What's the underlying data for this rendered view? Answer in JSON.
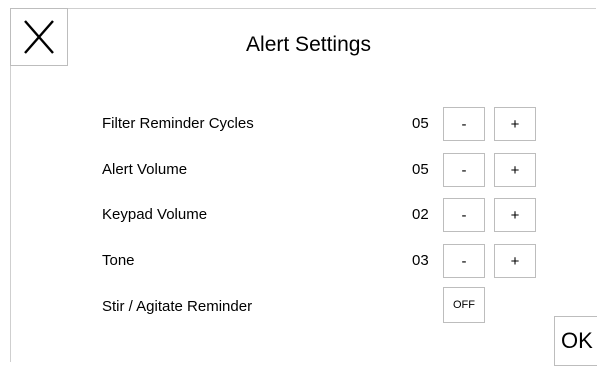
{
  "header": {
    "close_label": "X",
    "title": "Alert Settings"
  },
  "settings": [
    {
      "label": "Filter Reminder Cycles",
      "value": "05",
      "minus": "-",
      "plus": "+"
    },
    {
      "label": "Alert Volume",
      "value": "05",
      "minus": "-",
      "plus": "+"
    },
    {
      "label": "Keypad Volume",
      "value": "02",
      "minus": "-",
      "plus": "+"
    },
    {
      "label": "Tone",
      "value": "03",
      "minus": "-",
      "plus": "+"
    }
  ],
  "stir_reminder": {
    "label": "Stir / Agitate Reminder",
    "toggle_label": "OFF"
  },
  "footer": {
    "ok_label": "OK"
  },
  "colors": {
    "border": "#bdbdbd",
    "text": "#000000",
    "background": "#ffffff"
  }
}
